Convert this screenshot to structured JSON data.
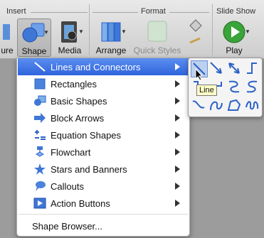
{
  "ribbon": {
    "groups": {
      "insert": "Insert",
      "format": "Format",
      "slideshow": "Slide Show"
    },
    "buttons": {
      "picture_partial": "ure",
      "shape": "Shape",
      "media": "Media",
      "arrange": "Arrange",
      "quick_styles": "Quick Styles",
      "play": "Play"
    }
  },
  "menu": {
    "items": [
      {
        "label": "Lines and Connectors",
        "icon": "line-connector-icon"
      },
      {
        "label": "Rectangles",
        "icon": "rectangle-icon"
      },
      {
        "label": "Basic Shapes",
        "icon": "basic-shapes-icon"
      },
      {
        "label": "Block Arrows",
        "icon": "block-arrow-icon"
      },
      {
        "label": "Equation Shapes",
        "icon": "equation-icon"
      },
      {
        "label": "Flowchart",
        "icon": "flowchart-icon"
      },
      {
        "label": "Stars and Banners",
        "icon": "star-icon"
      },
      {
        "label": "Callouts",
        "icon": "callout-icon"
      },
      {
        "label": "Action Buttons",
        "icon": "action-button-icon"
      }
    ],
    "shape_browser": "Shape Browser..."
  },
  "submenu": {
    "tooltip": "Line",
    "shapes": [
      "line",
      "arrow",
      "double-arrow",
      "elbow-connector",
      "elbow-arrow",
      "elbow-double-arrow",
      "curved-connector",
      "curved-arrow",
      "curved-double-arrow",
      "curve",
      "freeform",
      "scribble"
    ]
  },
  "colors": {
    "accent": "#2f64dc",
    "shape_blue": "#2d62c8"
  }
}
